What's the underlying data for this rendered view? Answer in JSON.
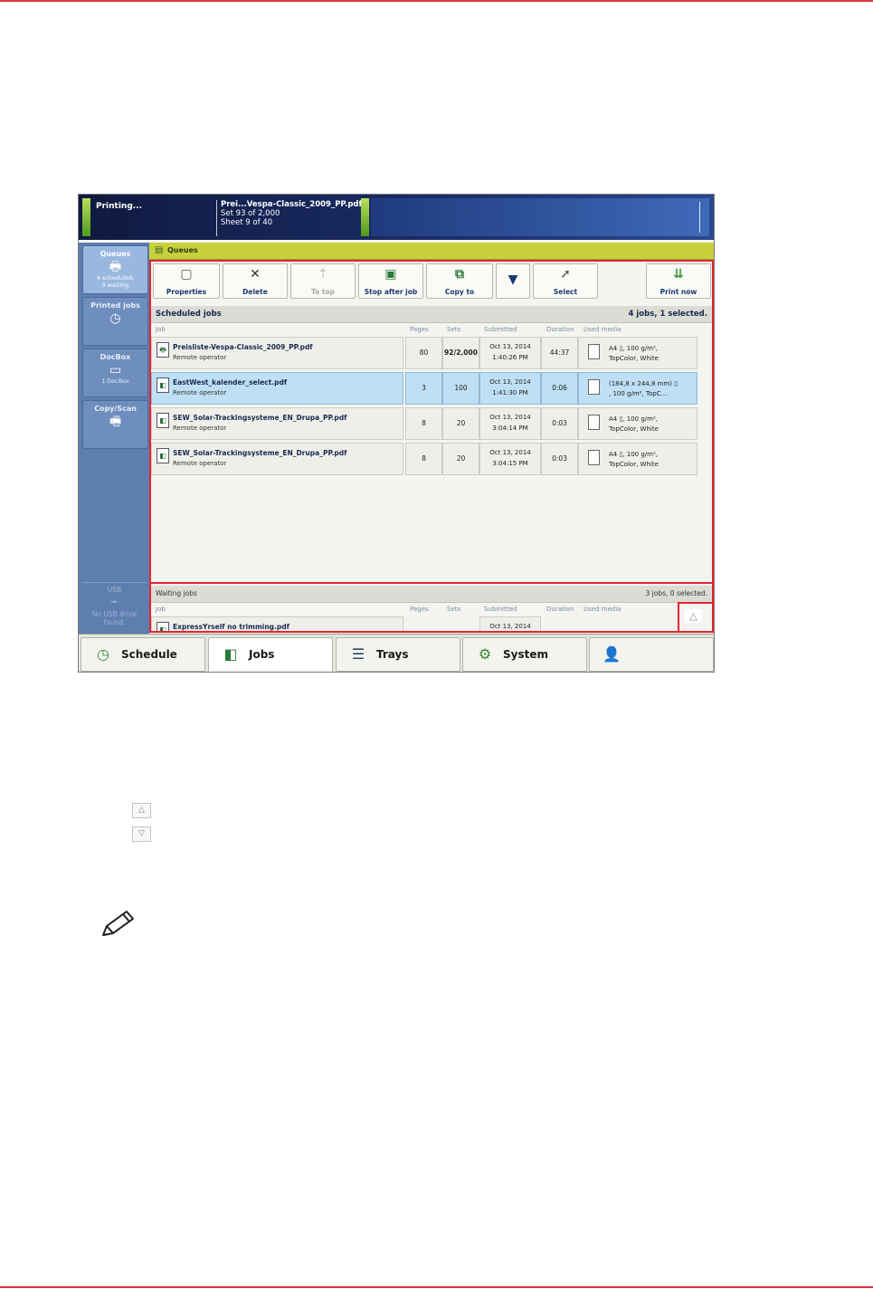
{
  "header": {
    "status": "Printing...",
    "job_title": "Prei...Vespa-Classic_2009_PP.pdf",
    "job_set": "Set 93 of 2,000",
    "job_sheet": "Sheet 9 of 40"
  },
  "nav": {
    "queues": {
      "label": "Queues",
      "sub1": "4 scheduled,",
      "sub2": "3 waiting"
    },
    "printed": {
      "label": "Printed jobs"
    },
    "docbox": {
      "label": "DocBox",
      "sub": "1 DocBox"
    },
    "copyscan": {
      "label": "Copy/Scan"
    },
    "usb": {
      "label": "USB",
      "sub": "No USB drive found."
    }
  },
  "queues_bar": {
    "label": "Queues"
  },
  "toolbar": {
    "properties": "Properties",
    "delete": "Delete",
    "to_top": "To top",
    "stop_after_job": "Stop after job",
    "copy_to": "Copy to",
    "select": "Select",
    "print_now": "Print now"
  },
  "scheduled": {
    "title": "Scheduled jobs",
    "summary": "4 jobs, 1 selected.",
    "columns": [
      "Job",
      "Pages",
      "Sets",
      "Submitted",
      "Duration",
      "Used media"
    ],
    "rows": [
      {
        "name": "Preisliste-Vespa-Classic_2009_PP.pdf",
        "operator": "Remote operator",
        "pages": "80",
        "sets": "92/2,000",
        "date": "Oct 13, 2014",
        "time": "1:40:26 PM",
        "duration": "44:37",
        "media1": "A4 ▯, 100 g/m², ",
        "media2": "TopColor, White"
      },
      {
        "name": "EastWest_kalender_select.pdf",
        "operator": "Remote operator",
        "pages": "3",
        "sets": "100",
        "date": "Oct 13, 2014",
        "time": "1:41:30 PM",
        "duration": "0:06",
        "media1": "(184,8 x 244,8 mm) ▯",
        "media2": ", 100 g/m², TopC..."
      },
      {
        "name": "SEW_Solar-Trackingsysteme_EN_Drupa_PP.pdf",
        "operator": "Remote operator",
        "pages": "8",
        "sets": "20",
        "date": "Oct 13, 2014",
        "time": "3:04:14 PM",
        "duration": "0:03",
        "media1": "A4 ▯, 100 g/m², ",
        "media2": "TopColor, White"
      },
      {
        "name": "SEW_Solar-Trackingsysteme_EN_Drupa_PP.pdf",
        "operator": "Remote operator",
        "pages": "8",
        "sets": "20",
        "date": "Oct 13, 2014",
        "time": "3:04:15 PM",
        "duration": "0:03",
        "media1": "A4 ▯, 100 g/m², ",
        "media2": "TopColor, White"
      }
    ]
  },
  "waiting": {
    "title": "Waiting jobs",
    "summary": "3 jobs, 0 selected.",
    "columns": [
      "Job",
      "Pages",
      "Sets",
      "Submitted",
      "Duration",
      "Used media"
    ],
    "rows": [
      {
        "name": "ExpressYrself no trimming.pdf",
        "date": "Oct 13, 2014"
      }
    ]
  },
  "tabs": {
    "schedule": "Schedule",
    "jobs": "Jobs",
    "trays": "Trays",
    "system": "System"
  },
  "colors": {
    "accent_red": "#e32530",
    "queues_bar": "#c7d13b",
    "nav_blue": "#5d7fb0",
    "selected_row": "#bfe0f4"
  }
}
